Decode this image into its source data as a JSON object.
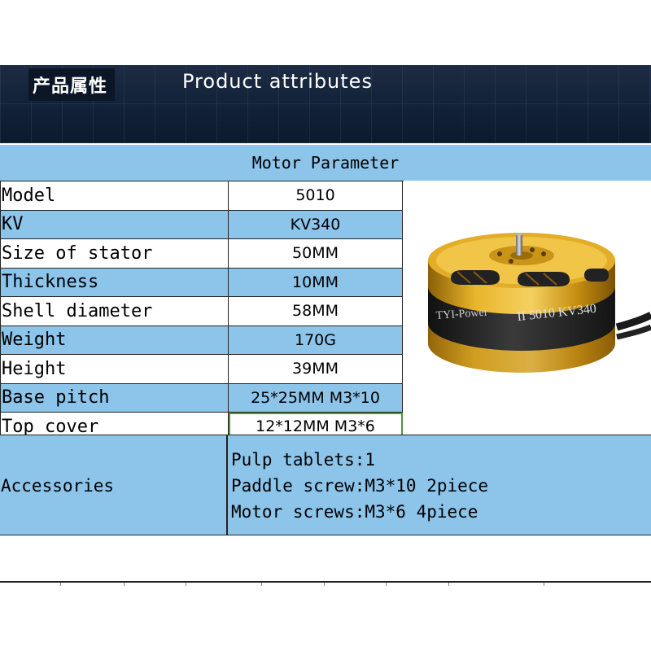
{
  "banner": {
    "title_cn": "产品属性",
    "title_en": "Product attributes"
  },
  "table": {
    "header": "Motor Parameter",
    "rows": [
      {
        "label": "Model",
        "value": "5010"
      },
      {
        "label": "KV",
        "value": "KV340"
      },
      {
        "label": "Size of stator",
        "value": "50MM"
      },
      {
        "label": "Thickness",
        "value": "10MM"
      },
      {
        "label": "Shell diameter",
        "value": "58MM"
      },
      {
        "label": "Weight",
        "value": "170G"
      },
      {
        "label": "Height",
        "value": "39MM"
      },
      {
        "label": "Base pitch",
        "value": "25*25MM M3*10"
      },
      {
        "label": "Top cover",
        "value": "12*12MM M3*6"
      }
    ]
  },
  "motor_image": {
    "brand_text": "TYI-Power",
    "model_text": "II 5010 KV340"
  },
  "accessories": {
    "label": "Accessories",
    "items": [
      "Pulp tablets:1",
      "Paddle screw:M3*10 2piece",
      "Motor screws:M3*6 4piece"
    ]
  },
  "colors": {
    "row_blue": "#8dc4ea",
    "banner_dark": "#13233a",
    "motor_gold": "#d9a51c"
  }
}
